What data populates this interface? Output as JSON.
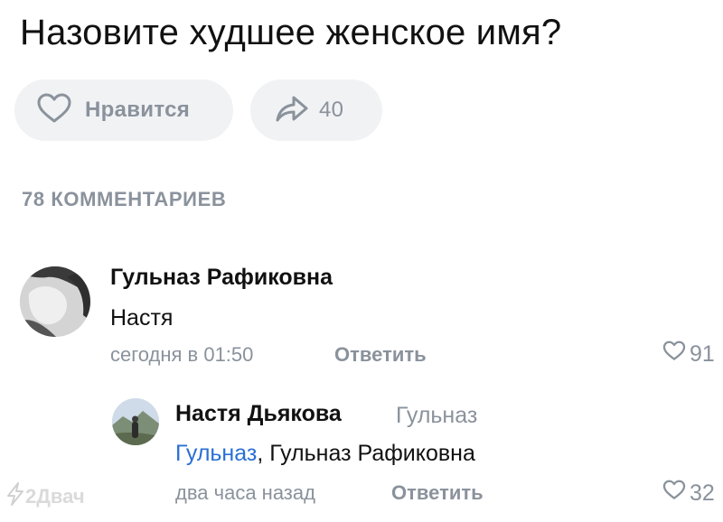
{
  "post": {
    "title": "Назовите худшее женское имя?",
    "like_label": "Нравится",
    "like_icon": "heart-outline-icon",
    "share_icon": "share-arrow-icon",
    "share_count": "40",
    "comments_count_label": "78 КОММЕНТАРИЕВ"
  },
  "comments": [
    {
      "author": "Гульназ Рафиковна",
      "text": "Настя",
      "time": "сегодня в 01:50",
      "reply_label": "Ответить",
      "likes": "91"
    },
    {
      "author": "Настя Дьякова",
      "reply_to": "Гульназ",
      "mention": "Гульназ",
      "text_rest": ", Гульназ Рафиковна",
      "time": "два часа назад",
      "reply_label": "Ответить",
      "likes": "32"
    }
  ],
  "watermark": "2Двач",
  "colors": {
    "accent_link": "#2a6fd6",
    "muted": "#8a929c",
    "pill_bg": "#f1f2f4"
  }
}
